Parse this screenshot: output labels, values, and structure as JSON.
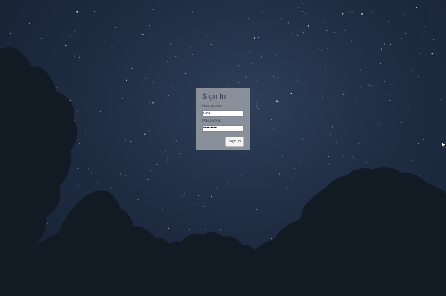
{
  "login": {
    "title": "Sign In",
    "username_label": "Username",
    "username_value": "test",
    "password_label": "Password",
    "password_value": "•••••••••",
    "submit_label": "Sign In"
  },
  "background": {
    "scene": "night-sky-with-tree-silhouettes",
    "sky_color": "#1f2c42",
    "tree_color": "#121a24"
  },
  "cursor": {
    "icon": "mouse-pointer-icon"
  }
}
